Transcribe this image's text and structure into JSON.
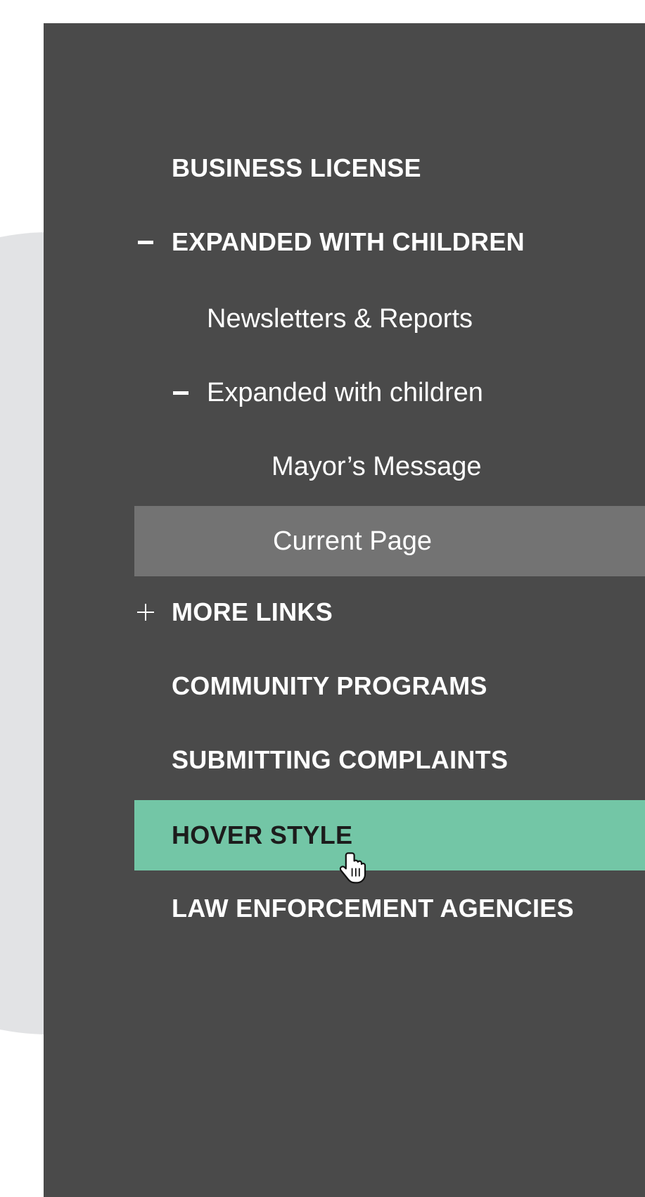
{
  "nav": {
    "items": [
      {
        "label": "BUSINESS LICENSE"
      },
      {
        "label": "EXPANDED WITH CHILDREN",
        "toggle": "collapse-minus-icon"
      },
      {
        "label": "Newsletters & Reports"
      },
      {
        "label": "Expanded with children",
        "toggle": "collapse-minus-icon"
      },
      {
        "label": "Mayor’s Message"
      },
      {
        "label": "Current Page",
        "state": "current"
      },
      {
        "label": "MORE LINKS",
        "toggle": "expand-plus-icon"
      },
      {
        "label": "COMMUNITY PROGRAMS"
      },
      {
        "label": "SUBMITTING COMPLAINTS"
      },
      {
        "label": "HOVER STYLE",
        "state": "hover"
      },
      {
        "label": "LAW ENFORCEMENT AGENCIES"
      }
    ]
  },
  "colors": {
    "panel_bg": "#4a4a4a",
    "current_bg": "#737373",
    "hover_bg": "#73c6a6",
    "hover_text": "#1c1c1c",
    "text": "#ffffff",
    "background_shape": "#e2e3e5"
  },
  "cursor": "hand-pointer-icon"
}
